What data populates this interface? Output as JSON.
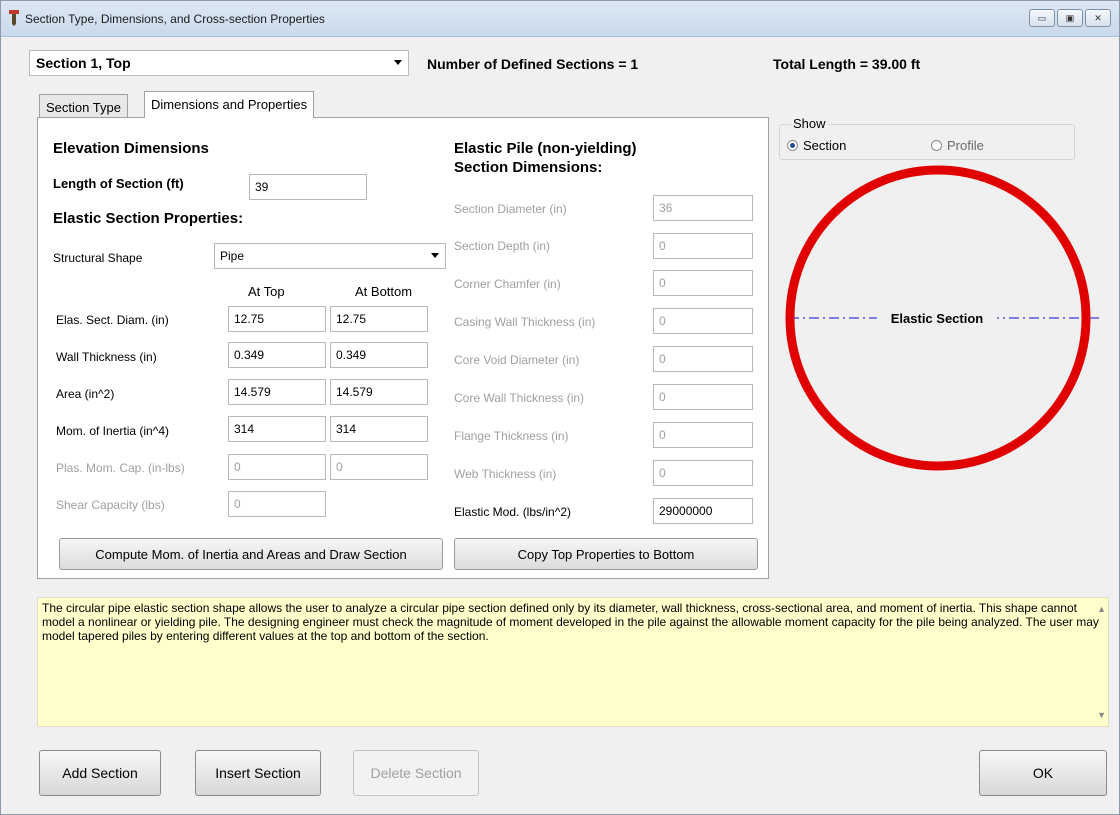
{
  "window": {
    "title": "Section Type, Dimensions, and Cross-section Properties",
    "controls": [
      "minimize-icon",
      "maximize-icon",
      "close-icon"
    ]
  },
  "header": {
    "section_selected": "Section 1, Top",
    "num_defined": "Number of Defined Sections = 1",
    "total_length": "Total Length = 39.00 ft"
  },
  "tabs": [
    {
      "label": "Section Type",
      "active": false
    },
    {
      "label": "Dimensions and Properties",
      "active": true
    }
  ],
  "elevation": {
    "title": "Elevation Dimensions",
    "length_label": "Length of Section (ft)",
    "length_value": "39"
  },
  "elastic_props": {
    "title": "Elastic Section Properties:",
    "shape_label": "Structural Shape",
    "shape_value": "Pipe",
    "col_top": "At Top",
    "col_bottom": "At Bottom",
    "rows": [
      {
        "label": "Elas. Sect. Diam.  (in)",
        "top": "12.75",
        "bottom": "12.75",
        "enabled": true
      },
      {
        "label": "Wall Thickness (in)",
        "top": "0.349",
        "bottom": "0.349",
        "enabled": true
      },
      {
        "label": "Area (in^2)",
        "top": "14.579",
        "bottom": "14.579",
        "enabled": true
      },
      {
        "label": "Mom. of Inertia (in^4)",
        "top": "314",
        "bottom": "314",
        "enabled": true
      },
      {
        "label": "Plas. Mom. Cap. (in-lbs)",
        "top": "0",
        "bottom": "0",
        "enabled": false
      }
    ],
    "shear_label": "Shear Capacity (lbs)",
    "shear_value": "0"
  },
  "elastic_pile": {
    "title_line1": "Elastic Pile (non-yielding)",
    "title_line2": "Section Dimensions:",
    "rows": [
      {
        "label": "Section Diameter (in)",
        "value": "36",
        "enabled": false
      },
      {
        "label": "Section Depth (in)",
        "value": "0",
        "enabled": false
      },
      {
        "label": "Corner Chamfer (in)",
        "value": "0",
        "enabled": false
      },
      {
        "label": "Casing Wall Thickness (in)",
        "value": "0",
        "enabled": false
      },
      {
        "label": "Core Void Diameter (in)",
        "value": "0",
        "enabled": false
      },
      {
        "label": "Core Wall Thickness (in)",
        "value": "0",
        "enabled": false
      },
      {
        "label": "Flange Thickness (in)",
        "value": "0",
        "enabled": false
      },
      {
        "label": "Web Thickness (in)",
        "value": "0",
        "enabled": false
      },
      {
        "label": "Elastic Mod. (lbs/in^2)",
        "value": "29000000",
        "enabled": true
      }
    ]
  },
  "buttons": {
    "compute": "Compute Mom. of Inertia and Areas and Draw Section",
    "copy": "Copy Top Properties to Bottom",
    "add": "Add Section",
    "insert": "Insert Section",
    "delete": "Delete Section",
    "ok": "OK"
  },
  "show": {
    "legend": "Show",
    "option_section": "Section",
    "option_profile": "Profile",
    "selected": "Section"
  },
  "drawing": {
    "label": "Elastic Section",
    "ring_color": "#e00000",
    "axis_color": "#3a3adc"
  },
  "description": "The circular pipe elastic section shape allows the user to analyze a circular pipe section defined only by its diameter, wall thickness, cross-sectional area, and moment of inertia. This shape cannot model a nonlinear or yielding pile. The designing engineer must check the magnitude of moment developed in the pile against the allowable moment capacity for the pile being analyzed. The user may model tapered piles by entering different values at the top and bottom of the section."
}
